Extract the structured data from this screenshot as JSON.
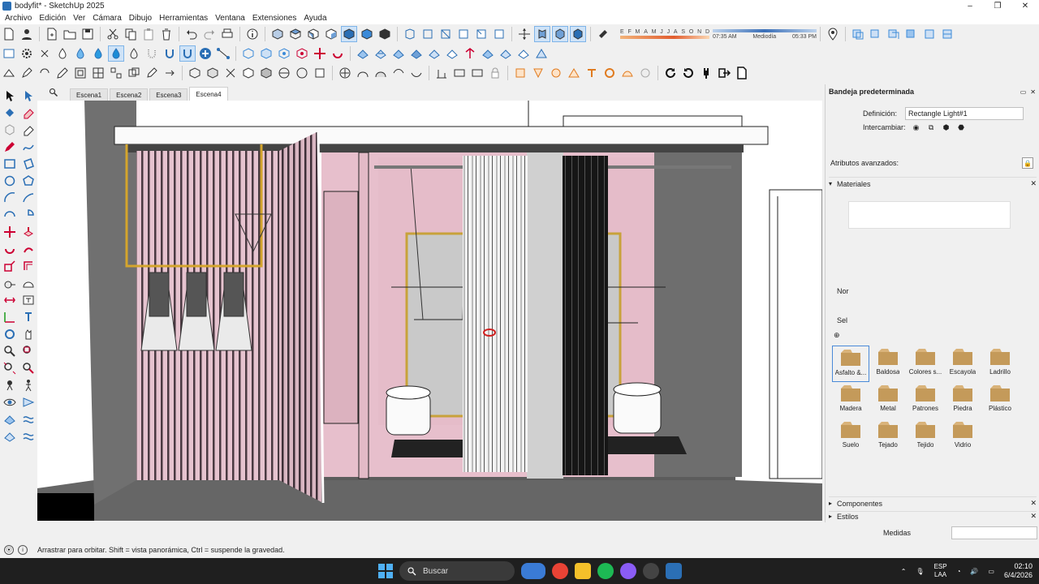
{
  "window": {
    "title": "bodyfit* - SketchUp 2025",
    "controls": [
      "–",
      "❐",
      "✕"
    ]
  },
  "menu": [
    "Archivo",
    "Edición",
    "Ver",
    "Cámara",
    "Dibujo",
    "Herramientas",
    "Ventana",
    "Extensiones",
    "Ayuda"
  ],
  "shadows": {
    "months": [
      "E",
      "F",
      "M",
      "A",
      "M",
      "J",
      "J",
      "A",
      "S",
      "O",
      "N",
      "D"
    ],
    "time_start": "07:35 AM",
    "time_mid": "Mediodía",
    "time_end": "05:33 PM"
  },
  "scenes": {
    "tabs": [
      "Escena1",
      "Escena2",
      "Escena3",
      "Escena4"
    ],
    "active": "Escena4"
  },
  "tray": {
    "title": "Bandeja predeterminada",
    "definition_label": "Definición:",
    "definition_value": "Rectangle Light#1",
    "swap_label": "Intercambiar:",
    "advanced_label": "Atributos avanzados:",
    "materials_label": "Materiales",
    "name_stub": "Nor",
    "select_stub": "Sel",
    "materials": [
      "Asfalto &...",
      "Baldosa",
      "Colores s...",
      "Escayola",
      "Ladrillo",
      "Madera",
      "Metal",
      "Patrones",
      "Piedra",
      "Plástico",
      "Suelo",
      "Tejado",
      "Tejido",
      "Vidrio"
    ],
    "selected_material": "Asfalto &...",
    "components_label": "Componentes",
    "styles_label": "Estilos",
    "measures_label": "Medidas"
  },
  "status": {
    "message": "Arrastrar para orbitar. Shift = vista panorámica, Ctrl = suspende la gravedad."
  },
  "taskbar": {
    "search_placeholder": "Buscar",
    "lang_top": "ESP",
    "lang_bottom": "LAA",
    "time": "02:10",
    "date": "6/4/2026"
  },
  "colors": {
    "accent": "#2b6fb5",
    "pink_wall": "#e8bfcc",
    "stripe_dark": "#4a3a42",
    "gold_rail": "#d4a52c",
    "dark_gray": "#6e6e6e",
    "floor": "#5a5a5a"
  }
}
